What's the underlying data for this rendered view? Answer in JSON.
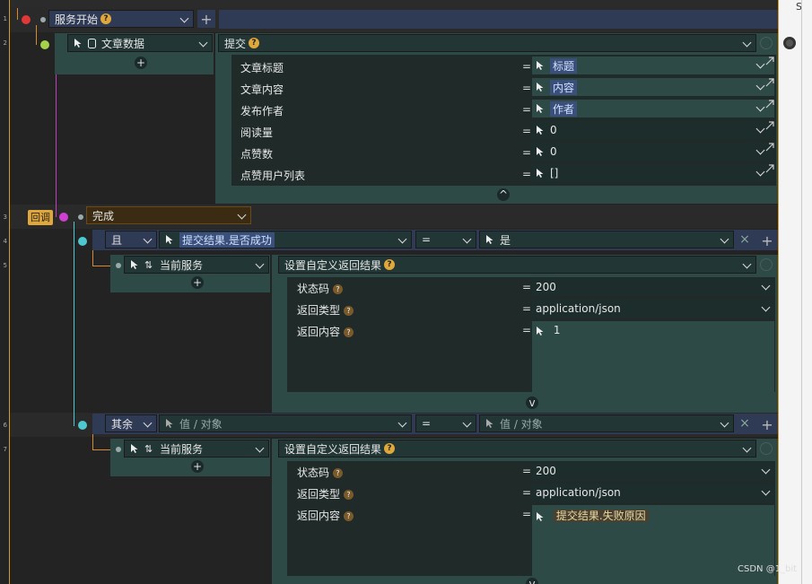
{
  "gutter": {
    "line_numbers": [
      "1",
      "2",
      "3",
      "4",
      "5",
      "6",
      "7"
    ]
  },
  "row1": {
    "node_label": "服务开始",
    "help": "?"
  },
  "row2": {
    "object_label": "文章数据",
    "action_label": "提交",
    "help": "?"
  },
  "submit_params": [
    {
      "label": "文章标题",
      "eq": "=",
      "value": "标题",
      "chip": true
    },
    {
      "label": "文章内容",
      "eq": "=",
      "value": "内容",
      "chip": true
    },
    {
      "label": "发布作者",
      "eq": "=",
      "value": "作者",
      "chip": true
    },
    {
      "label": "阅读量",
      "eq": "=",
      "value": "0",
      "chip": false
    },
    {
      "label": "点赞数",
      "eq": "=",
      "value": "0",
      "chip": false
    },
    {
      "label": "点赞用户列表",
      "eq": "=",
      "value": "[]",
      "chip": false
    }
  ],
  "row3": {
    "badge": "回调",
    "event": "完成"
  },
  "row4": {
    "logic": "且",
    "left_operand": "提交结果.是否成功",
    "operator": "=",
    "right_operand": "是"
  },
  "row5": {
    "object_label": "当前服务",
    "action_label": "设置自定义返回结果",
    "help": "?",
    "params": [
      {
        "label": "状态码",
        "eq": "=",
        "value": "200"
      },
      {
        "label": "返回类型",
        "eq": "=",
        "value": "application/json"
      },
      {
        "label": "返回内容",
        "eq": "=",
        "value": "1"
      }
    ]
  },
  "row6": {
    "logic": "其余",
    "left_placeholder": "值 / 对象",
    "operator": "=",
    "right_placeholder": "值 / 对象"
  },
  "row7": {
    "object_label": "当前服务",
    "action_label": "设置自定义返回结果",
    "help": "?",
    "params": [
      {
        "label": "状态码",
        "eq": "=",
        "value": "200"
      },
      {
        "label": "返回类型",
        "eq": "=",
        "value": "application/json"
      },
      {
        "label": "返回内容",
        "eq": "=",
        "value": "提交结果.失败原因"
      }
    ]
  },
  "watermark": "CSDN @1_bit",
  "right_edge_char": "S",
  "colors": {
    "accent_border": "#d49a2a",
    "node_red": "#e03838",
    "node_green": "#a6d24a",
    "node_magenta": "#d040d0",
    "node_cyan": "#4ec8d0",
    "chip": "#3a4f7a"
  }
}
